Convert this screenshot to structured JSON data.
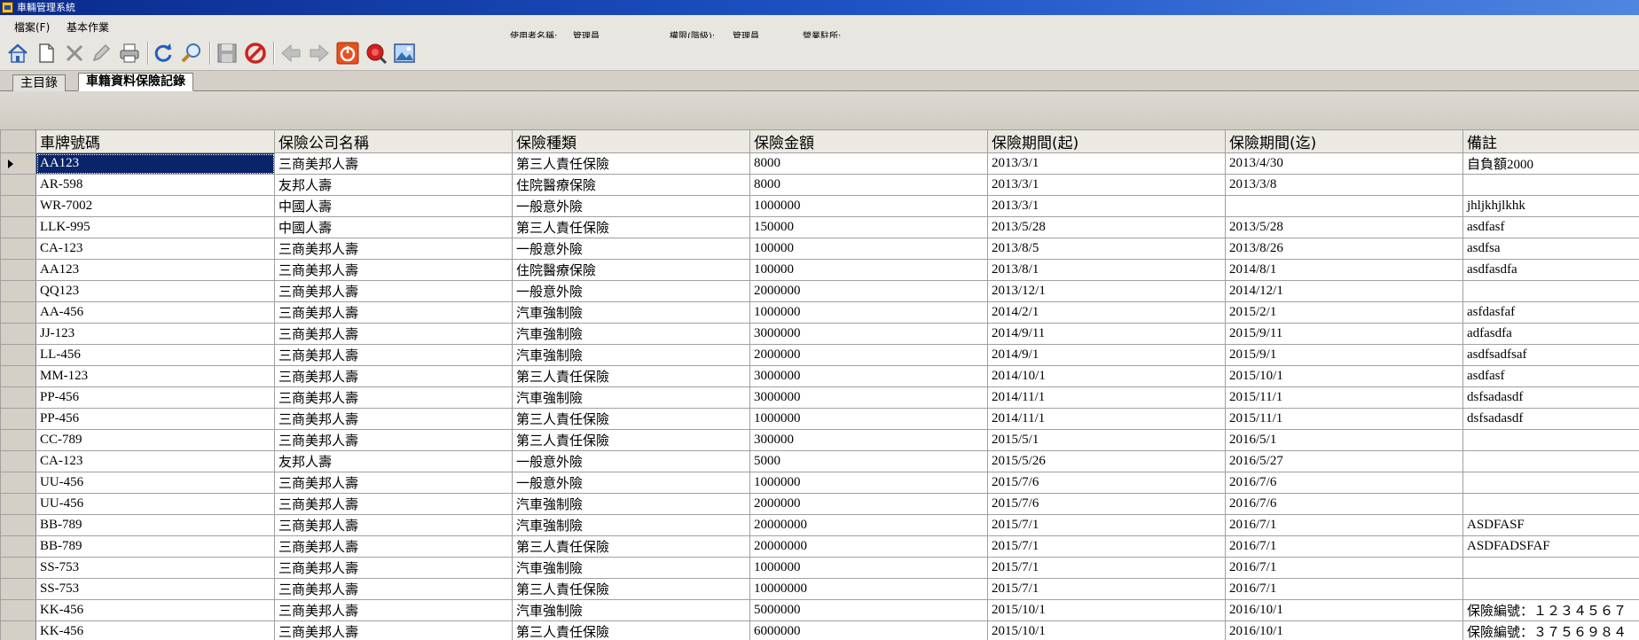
{
  "window": {
    "title": "車輛管理系統"
  },
  "menu": {
    "file": "檔案(F)",
    "basic": "基本作業"
  },
  "status": {
    "user_label": "使用者名稱:",
    "user_value": "管理員",
    "perm_label": "權限(階級):",
    "perm_value": "管理員",
    "office_label": "營業駐所:"
  },
  "toolbar": {
    "icons": [
      "home-icon",
      "new-document-icon",
      "delete-icon",
      "edit-icon",
      "print-icon",
      "refresh-icon",
      "search-icon",
      "save-icon",
      "cancel-icon",
      "previous-icon",
      "next-icon",
      "power-icon",
      "alarm-icon",
      "picture-icon"
    ]
  },
  "tabs": {
    "home": "主目錄",
    "insurance": "車籍資料保險記錄"
  },
  "grid": {
    "columns": [
      "車牌號碼",
      "保險公司名稱",
      "保險種類",
      "保險金額",
      "保險期間(起)",
      "保險期間(迄)",
      "備註"
    ],
    "rows": [
      [
        "AA123",
        "三商美邦人壽",
        "第三人責任保險",
        "8000",
        "2013/3/1",
        "2013/4/30",
        "自負額2000"
      ],
      [
        "AR-598",
        "友邦人壽",
        "住院醫療保險",
        "8000",
        "2013/3/1",
        "2013/3/8",
        ""
      ],
      [
        "WR-7002",
        "中國人壽",
        "一般意外險",
        "1000000",
        "2013/3/1",
        "",
        "jhljkhjlkhk"
      ],
      [
        "LLK-995",
        "中國人壽",
        "第三人責任保險",
        "150000",
        "2013/5/28",
        "2013/5/28",
        "asdfasf"
      ],
      [
        "CA-123",
        "三商美邦人壽",
        "一般意外險",
        "100000",
        "2013/8/5",
        "2013/8/26",
        "asdfsa"
      ],
      [
        "AA123",
        "三商美邦人壽",
        "住院醫療保險",
        "100000",
        "2013/8/1",
        "2014/8/1",
        "asdfasdfa"
      ],
      [
        "QQ123",
        "三商美邦人壽",
        "一般意外險",
        "2000000",
        "2013/12/1",
        "2014/12/1",
        ""
      ],
      [
        "AA-456",
        "三商美邦人壽",
        "汽車強制險",
        "1000000",
        "2014/2/1",
        "2015/2/1",
        "asfdasfaf"
      ],
      [
        "JJ-123",
        "三商美邦人壽",
        "汽車強制險",
        "3000000",
        "2014/9/11",
        "2015/9/11",
        "adfasdfa"
      ],
      [
        "LL-456",
        "三商美邦人壽",
        "汽車強制險",
        "2000000",
        "2014/9/1",
        "2015/9/1",
        "asdfsadfsaf"
      ],
      [
        "MM-123",
        "三商美邦人壽",
        "第三人責任保險",
        "3000000",
        "2014/10/1",
        "2015/10/1",
        "asdfasf"
      ],
      [
        "PP-456",
        "三商美邦人壽",
        "汽車強制險",
        "3000000",
        "2014/11/1",
        "2015/11/1",
        "dsfsadasdf"
      ],
      [
        "PP-456",
        "三商美邦人壽",
        "第三人責任保險",
        "1000000",
        "2014/11/1",
        "2015/11/1",
        "dsfsadasdf"
      ],
      [
        "CC-789",
        "三商美邦人壽",
        "第三人責任保險",
        "300000",
        "2015/5/1",
        "2016/5/1",
        ""
      ],
      [
        "CA-123",
        "友邦人壽",
        "一般意外險",
        "5000",
        "2015/5/26",
        "2016/5/27",
        ""
      ],
      [
        "UU-456",
        "三商美邦人壽",
        "一般意外險",
        "1000000",
        "2015/7/6",
        "2016/7/6",
        ""
      ],
      [
        "UU-456",
        "三商美邦人壽",
        "汽車強制險",
        "2000000",
        "2015/7/6",
        "2016/7/6",
        ""
      ],
      [
        "BB-789",
        "三商美邦人壽",
        "汽車強制險",
        "20000000",
        "2015/7/1",
        "2016/7/1",
        "ASDFASF"
      ],
      [
        "BB-789",
        "三商美邦人壽",
        "第三人責任保險",
        "20000000",
        "2015/7/1",
        "2016/7/1",
        "ASDFADSFAF"
      ],
      [
        "SS-753",
        "三商美邦人壽",
        "汽車強制險",
        "1000000",
        "2015/7/1",
        "2016/7/1",
        ""
      ],
      [
        "SS-753",
        "三商美邦人壽",
        "第三人責任保險",
        "10000000",
        "2015/7/1",
        "2016/7/1",
        ""
      ],
      [
        "KK-456",
        "三商美邦人壽",
        "汽車強制險",
        "5000000",
        "2015/10/1",
        "2016/10/1",
        "保險編號：１２３４５６７"
      ],
      [
        "KK-456",
        "三商美邦人壽",
        "第三人責任保險",
        "6000000",
        "2015/10/1",
        "2016/10/1",
        "保險編號：３７５６９８４"
      ]
    ]
  }
}
